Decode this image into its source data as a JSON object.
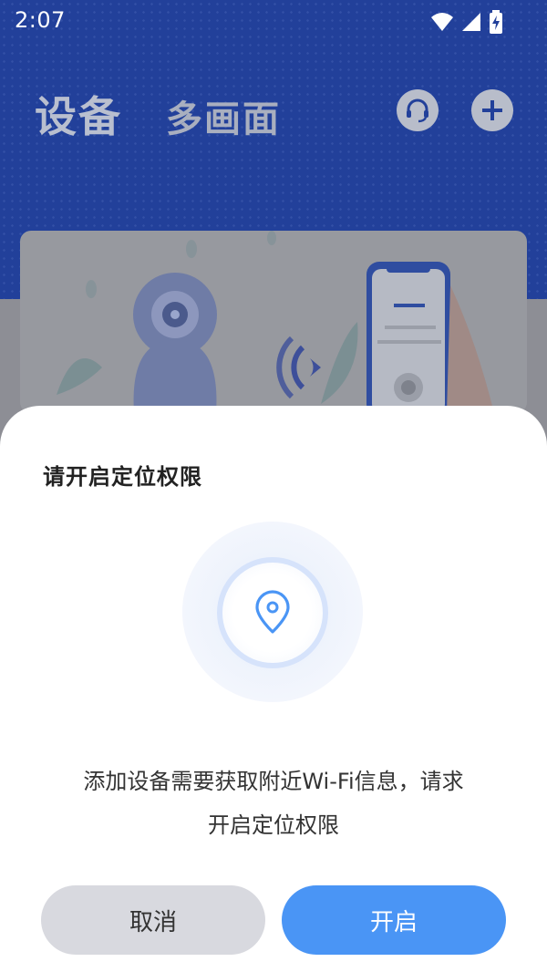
{
  "status": {
    "time": "2:07"
  },
  "header": {
    "tab_devices": "设备",
    "tab_multiview": "多画面",
    "icons": [
      "headset-icon",
      "plus-icon"
    ]
  },
  "dialog": {
    "title": "请开启定位权限",
    "message_line1": "添加设备需要获取附近Wi-Fi信息，请求",
    "message_line2": "开启定位权限",
    "cancel_label": "取消",
    "confirm_label": "开启",
    "icon": "location-pin-icon"
  },
  "colors": {
    "header_bg": "#22409a",
    "accent": "#4a95f5",
    "cancel_bg": "#d8d9df"
  }
}
